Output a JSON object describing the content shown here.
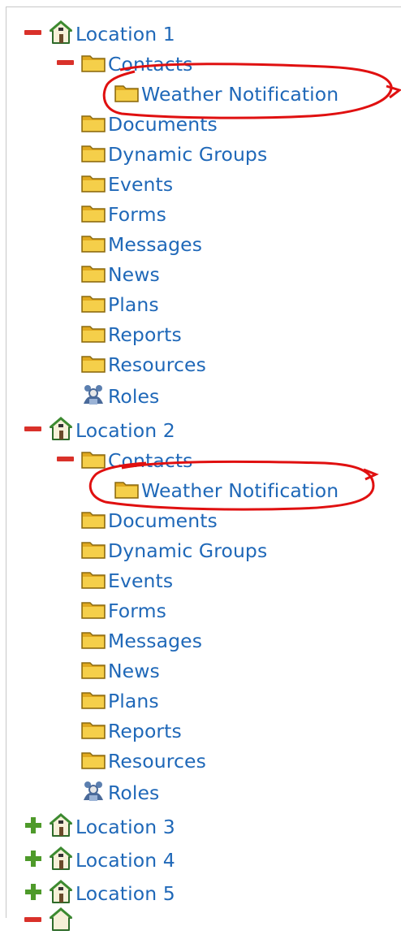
{
  "tree": [
    {
      "label": "Location 1",
      "kind": "location",
      "expanded": true
    },
    {
      "label": "Contacts",
      "kind": "folder",
      "expanded": true
    },
    {
      "label": "Weather Notification",
      "kind": "folder"
    },
    {
      "label": "Documents",
      "kind": "folder"
    },
    {
      "label": "Dynamic Groups",
      "kind": "folder"
    },
    {
      "label": "Events",
      "kind": "folder"
    },
    {
      "label": "Forms",
      "kind": "folder"
    },
    {
      "label": "Messages",
      "kind": "folder"
    },
    {
      "label": "News",
      "kind": "folder"
    },
    {
      "label": "Plans",
      "kind": "folder"
    },
    {
      "label": "Reports",
      "kind": "folder"
    },
    {
      "label": "Resources",
      "kind": "folder"
    },
    {
      "label": "Roles",
      "kind": "roles"
    },
    {
      "label": "Location 2",
      "kind": "location",
      "expanded": true
    },
    {
      "label": "Contacts",
      "kind": "folder",
      "expanded": true
    },
    {
      "label": "Weather Notification",
      "kind": "folder"
    },
    {
      "label": "Documents",
      "kind": "folder"
    },
    {
      "label": "Dynamic Groups",
      "kind": "folder"
    },
    {
      "label": "Events",
      "kind": "folder"
    },
    {
      "label": "Forms",
      "kind": "folder"
    },
    {
      "label": "Messages",
      "kind": "folder"
    },
    {
      "label": "News",
      "kind": "folder"
    },
    {
      "label": "Plans",
      "kind": "folder"
    },
    {
      "label": "Reports",
      "kind": "folder"
    },
    {
      "label": "Resources",
      "kind": "folder"
    },
    {
      "label": "Roles",
      "kind": "roles"
    },
    {
      "label": "Location 3",
      "kind": "location",
      "expanded": false
    },
    {
      "label": "Location 4",
      "kind": "location",
      "expanded": false
    },
    {
      "label": "Location 5",
      "kind": "location",
      "expanded": false
    },
    {
      "label": "",
      "kind": "location",
      "expanded": true
    }
  ],
  "icons": {
    "collapse": "minus-icon",
    "expand": "plus-icon",
    "location": "house-icon",
    "folder": "folder-icon",
    "roles": "roles-icon"
  },
  "colors": {
    "link": "#1f68b8",
    "collapse_toggle": "#d9312a",
    "expand_toggle": "#4e9a2a",
    "annotation": "#e01010"
  }
}
